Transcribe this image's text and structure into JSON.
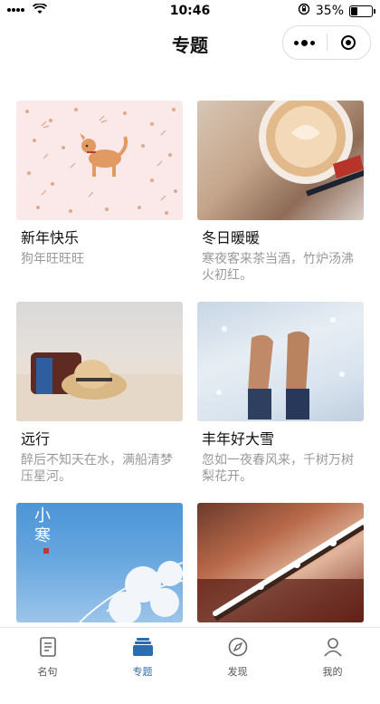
{
  "status_bar": {
    "time": "10:46",
    "battery": "35%",
    "battery_level": 0.35
  },
  "header": {
    "title": "专题"
  },
  "topics": [
    {
      "title": "新年快乐",
      "desc": "狗年旺旺旺",
      "image": "dog-pattern"
    },
    {
      "title": "冬日暖暖",
      "desc": "寒夜客来茶当酒，竹炉汤沸火初红。",
      "image": "coffee-cup"
    },
    {
      "title": "远行",
      "desc": "醉后不知天在水，满船清梦压星河。",
      "image": "beach-hat"
    },
    {
      "title": "丰年好大雪",
      "desc": "忽如一夜春风来，千树万树梨花开。",
      "image": "snow-boots"
    },
    {
      "title": "",
      "desc": "",
      "image": "frosted-branches",
      "overlay_text": "小寒"
    },
    {
      "title": "",
      "desc": "",
      "image": "snowy-branch"
    }
  ],
  "tabbar": {
    "items": [
      {
        "label": "名句",
        "icon": "document-icon",
        "active": false
      },
      {
        "label": "专题",
        "icon": "stack-icon",
        "active": true
      },
      {
        "label": "发现",
        "icon": "compass-icon",
        "active": false
      },
      {
        "label": "我的",
        "icon": "user-icon",
        "active": false
      }
    ]
  },
  "colors": {
    "accent": "#2b6cb0",
    "muted_text": "#999999"
  }
}
